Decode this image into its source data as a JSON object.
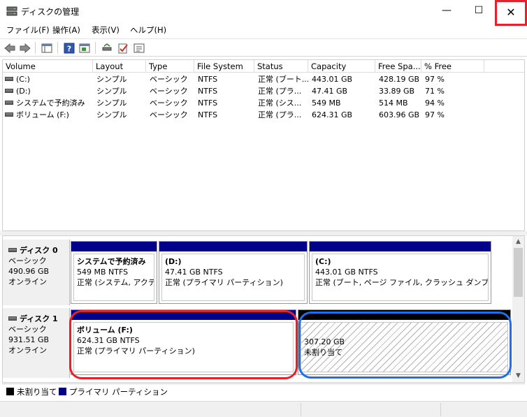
{
  "window": {
    "title": "ディスクの管理",
    "minimize_glyph": "—",
    "maximize_glyph": "☐",
    "close_glyph": "✕"
  },
  "menu": [
    "ファイル(F)",
    "操作(A)",
    "表示(V)",
    "ヘルプ(H)"
  ],
  "toolbar": {
    "icons": [
      "back-arrow-icon",
      "forward-arrow-icon",
      "console-tree-icon",
      "help-icon",
      "action-pane-icon",
      "connect-icon",
      "checklist-icon",
      "properties-icon"
    ]
  },
  "volume_list": {
    "columns": [
      "Volume",
      "Layout",
      "Type",
      "File System",
      "Status",
      "Capacity",
      "Free Spa...",
      "% Free"
    ],
    "rows": [
      {
        "volume": "(C:)",
        "layout": "シンプル",
        "type": "ベーシック",
        "fs": "NTFS",
        "status": "正常 (ブート...",
        "capacity": "443.01 GB",
        "free": "428.19 GB",
        "pct": "97 %"
      },
      {
        "volume": "(D:)",
        "layout": "シンプル",
        "type": "ベーシック",
        "fs": "NTFS",
        "status": "正常 (プラ...",
        "capacity": "47.41 GB",
        "free": "33.89 GB",
        "pct": "71 %"
      },
      {
        "volume": "システムで予約済み",
        "layout": "シンプル",
        "type": "ベーシック",
        "fs": "NTFS",
        "status": "正常 (シス...",
        "capacity": "549 MB",
        "free": "514 MB",
        "pct": "94 %"
      },
      {
        "volume": "ボリューム (F:)",
        "layout": "シンプル",
        "type": "ベーシック",
        "fs": "NTFS",
        "status": "正常 (プラ...",
        "capacity": "624.31 GB",
        "free": "603.96 GB",
        "pct": "97 %"
      }
    ]
  },
  "disks": [
    {
      "name": "ディスク 0",
      "type": "ベーシック",
      "size": "490.96 GB",
      "state": "オンライン",
      "partitions": [
        {
          "title": "システムで予約済み",
          "size": "549 MB NTFS",
          "status": "正常 (システム, アクティブ"
        },
        {
          "title": "(D:)",
          "size": "47.41 GB NTFS",
          "status": "正常 (プライマリ パーティション)"
        },
        {
          "title": "(C:)",
          "size": "443.01 GB NTFS",
          "status": "正常 (ブート, ページ ファイル, クラッシュ ダンプ, プライマ"
        }
      ]
    },
    {
      "name": "ディスク 1",
      "type": "ベーシック",
      "size": "931.51 GB",
      "state": "オンライン",
      "partitions": [
        {
          "title": "ボリューム (F:)",
          "size": "624.31 GB NTFS",
          "status": "正常 (プライマリ パーティション)"
        },
        {
          "title": "",
          "size": "307.20 GB",
          "status": "未割り当て"
        }
      ]
    }
  ],
  "legend": [
    {
      "label": "未割り当て",
      "color": "#000000"
    },
    {
      "label": "プライマリ パーティション",
      "color": "#00008b"
    }
  ],
  "colors": {
    "primary_bar": "#00008b",
    "unallocated_bar": "#000000",
    "highlight_red": "#e8202a",
    "highlight_blue": "#1e6ef0"
  }
}
